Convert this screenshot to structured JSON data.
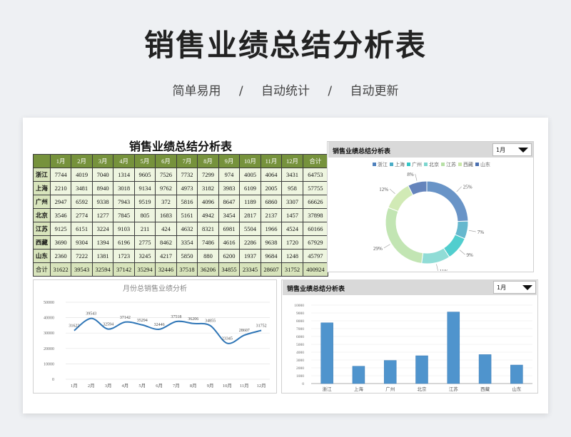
{
  "hero": {
    "title": "销售业绩总结分析表",
    "tags": [
      "简单易用",
      "/",
      "自动统计",
      "/",
      "自动更新"
    ]
  },
  "table": {
    "title": "销售业绩总结分析表",
    "headers": [
      "",
      "1月",
      "2月",
      "3月",
      "4月",
      "5月",
      "6月",
      "7月",
      "8月",
      "9月",
      "10月",
      "11月",
      "12月",
      "合计"
    ],
    "rows": [
      [
        "浙江",
        "7744",
        "4019",
        "7040",
        "1314",
        "9605",
        "7526",
        "7732",
        "7299",
        "974",
        "4005",
        "4064",
        "3431",
        "64753"
      ],
      [
        "上海",
        "2210",
        "3481",
        "8940",
        "3018",
        "9134",
        "9762",
        "4973",
        "3182",
        "3983",
        "6109",
        "2005",
        "958",
        "57755"
      ],
      [
        "广州",
        "2947",
        "6592",
        "9338",
        "7943",
        "9519",
        "372",
        "5816",
        "4096",
        "8647",
        "1189",
        "6860",
        "3307",
        "66626"
      ],
      [
        "北京",
        "3546",
        "2774",
        "1277",
        "7845",
        "805",
        "1683",
        "5161",
        "4942",
        "3454",
        "2817",
        "2137",
        "1457",
        "37898"
      ],
      [
        "江苏",
        "9125",
        "6151",
        "3224",
        "9103",
        "211",
        "424",
        "4632",
        "8321",
        "6981",
        "5504",
        "1966",
        "4524",
        "60166"
      ],
      [
        "西藏",
        "3690",
        "9304",
        "1394",
        "6196",
        "2775",
        "8462",
        "3354",
        "7486",
        "4616",
        "2286",
        "9638",
        "1720",
        "67929"
      ],
      [
        "山东",
        "2360",
        "7222",
        "1381",
        "1723",
        "3245",
        "4217",
        "5850",
        "880",
        "6200",
        "1937",
        "9684",
        "1248",
        "45797"
      ]
    ],
    "total": [
      "合计",
      "31622",
      "39543",
      "32594",
      "37142",
      "35294",
      "32446",
      "37518",
      "36206",
      "34855",
      "23345",
      "28607",
      "31752",
      "400924"
    ]
  },
  "donut_panel": {
    "title": "销售业绩总结分析表",
    "select_value": "1月"
  },
  "bar_panel": {
    "title": "销售业绩总结分析表",
    "select_value": "1月"
  },
  "chart_data": [
    {
      "type": "pie",
      "variant": "donut",
      "categories": [
        "浙江",
        "上海",
        "广州",
        "北京",
        "江苏",
        "西藏",
        "山东"
      ],
      "values": [
        7744,
        2210,
        2947,
        3546,
        9125,
        3690,
        2360
      ],
      "data_labels": [
        "25%",
        "7%",
        "9%",
        "11%",
        "29%",
        "12%",
        "8%"
      ],
      "colors": [
        "#4f81bd",
        "#4bacc6",
        "#33c6c6",
        "#7cd6cf",
        "#b7e0a6",
        "#c9e6a8",
        "#4a6fb0"
      ],
      "legend": "top"
    },
    {
      "type": "line",
      "title": "月份总销售业绩分析",
      "categories": [
        "1月",
        "2月",
        "3月",
        "4月",
        "5月",
        "6月",
        "7月",
        "8月",
        "9月",
        "10月",
        "11月",
        "12月"
      ],
      "values": [
        31622,
        39543,
        32594,
        37142,
        35294,
        32446,
        37518,
        36206,
        34855,
        23345,
        28607,
        31752
      ],
      "ylim": [
        0,
        50000
      ],
      "yticks": [
        0,
        10000,
        20000,
        30000,
        40000,
        50000
      ],
      "color": "#2e75b6",
      "grid": true
    },
    {
      "type": "bar",
      "categories": [
        "浙江",
        "上海",
        "广州",
        "北京",
        "江苏",
        "西藏",
        "山东"
      ],
      "values": [
        7744,
        2210,
        2947,
        3546,
        9125,
        3690,
        2360
      ],
      "ylim": [
        0,
        10000
      ],
      "yticks": [
        0,
        1000,
        2000,
        3000,
        4000,
        5000,
        6000,
        7000,
        8000,
        9000,
        10000
      ],
      "color": "#4f94cd",
      "grid": true
    }
  ]
}
